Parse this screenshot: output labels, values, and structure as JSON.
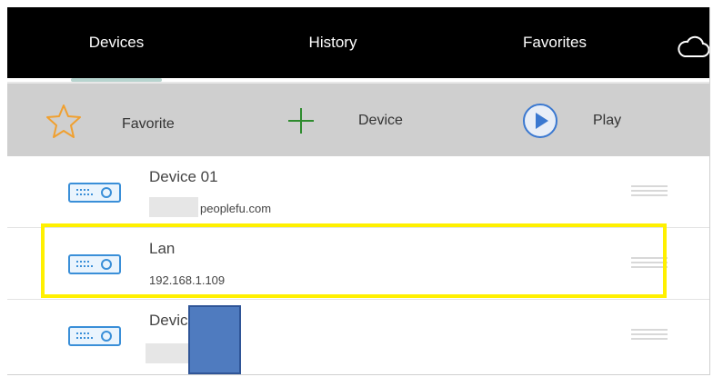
{
  "tabs": [
    {
      "label": "Devices",
      "active": true
    },
    {
      "label": "History",
      "active": false
    },
    {
      "label": "Favorites",
      "active": false
    }
  ],
  "header": {
    "cloud_icon": "cloud-icon"
  },
  "actions": {
    "favorite": {
      "label": "Favorite",
      "icon": "star-outline-icon",
      "color": "#f0a030"
    },
    "device": {
      "label": "Device",
      "icon": "plus-icon",
      "color": "#2e8b2e"
    },
    "play": {
      "label": "Play",
      "icon": "play-circle-icon",
      "color": "#3a78d0"
    }
  },
  "devices": [
    {
      "name": "Device 01",
      "address": "peoplefu.com"
    },
    {
      "name": "Lan",
      "address": "192.168.1.109"
    },
    {
      "name": "Devic",
      "address": ""
    }
  ],
  "colors": {
    "tab_bar": "#000000",
    "action_bar": "#cfcfcf",
    "device_icon": "#3a8fd8",
    "highlight": "#fff000",
    "mask": "#4f7bbf"
  }
}
